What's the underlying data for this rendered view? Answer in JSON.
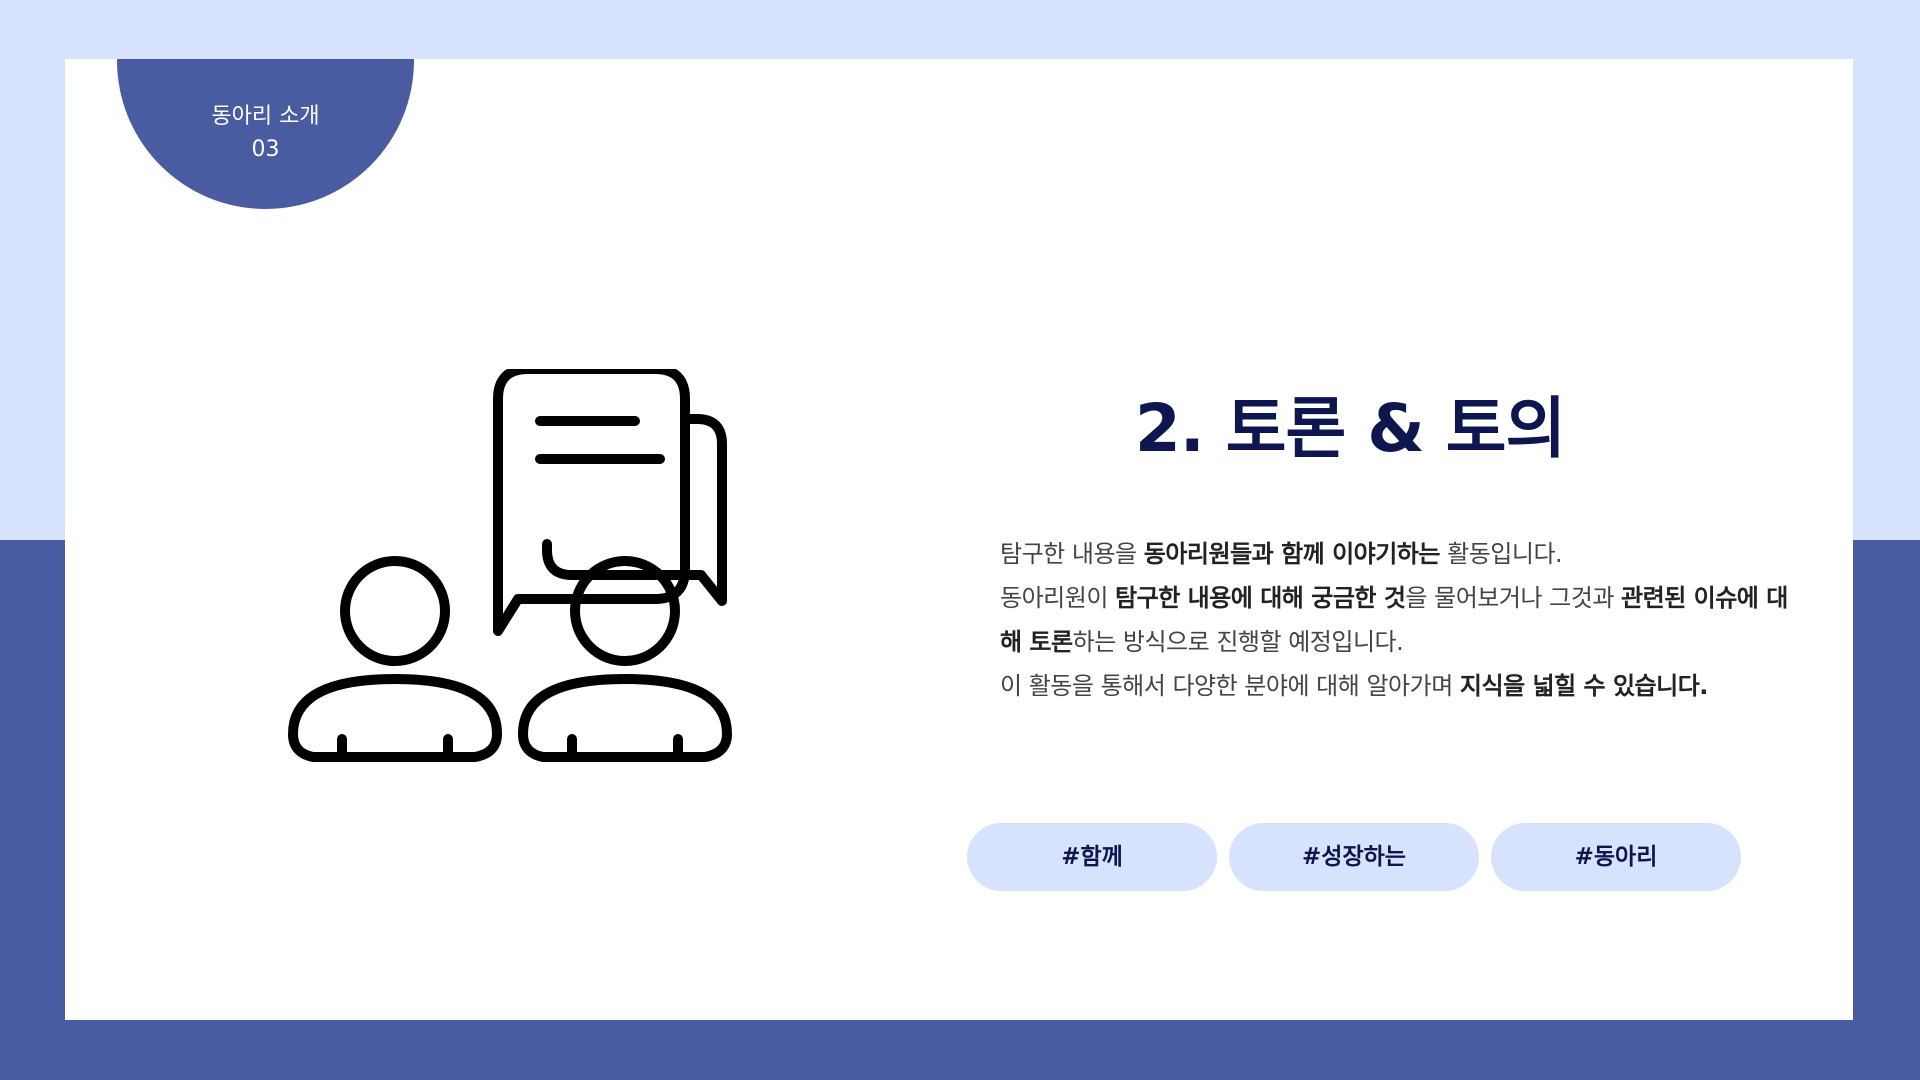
{
  "badge": {
    "line1": "동아리 소개",
    "line2": "03"
  },
  "title": "2. 토론 & 토의",
  "description": [
    [
      {
        "t": " 탐구한 내용을 ",
        "b": false
      },
      {
        "t": "동아리원들과 함께 이야기하는",
        "b": true
      },
      {
        "t": " 활동입니다.",
        "b": false
      }
    ],
    [
      {
        "t": "동아리원이 ",
        "b": false
      },
      {
        "t": "탐구한 내용에 대해 궁금한 것",
        "b": true
      },
      {
        "t": "을 물어보거나 그것과 ",
        "b": false
      },
      {
        "t": "관련된 이슈에 대해 토론",
        "b": true
      },
      {
        "t": "하는 방식으로 진행할 예정입니다.",
        "b": false
      }
    ],
    [
      {
        "t": "이 활동을 통해서 다양한 분야에 대해 알아가며 ",
        "b": false
      },
      {
        "t": "지식을 넓힐 수 있습니다.",
        "b": true
      }
    ]
  ],
  "tags": [
    "#함께",
    "#성장하는",
    "#동아리"
  ],
  "icons": {
    "illustration": "two-people-discussion-icon"
  },
  "colors": {
    "background_light": "#d7e3fd",
    "background_dark": "#495ca2",
    "title": "#0e1650",
    "tag_bg": "#d7e3fd"
  }
}
